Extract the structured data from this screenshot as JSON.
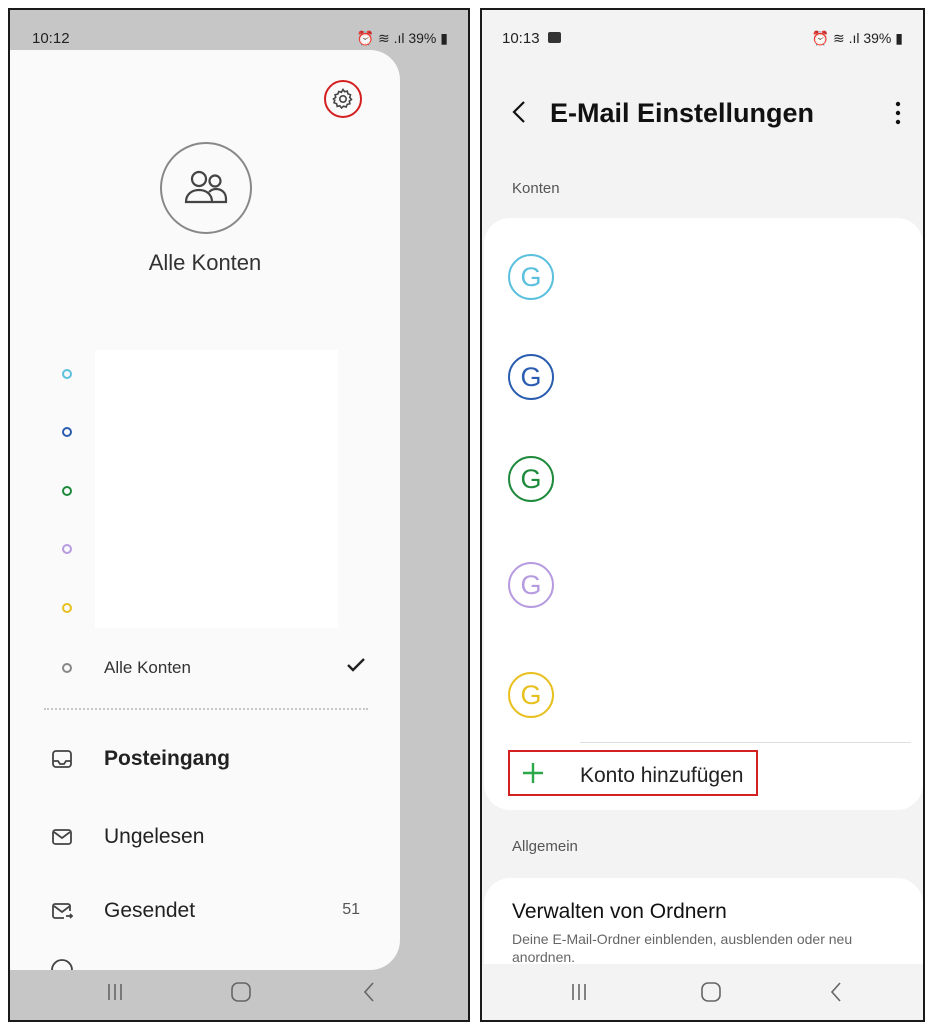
{
  "left": {
    "status": {
      "time": "10:12",
      "battery": "39%"
    },
    "drawer": {
      "settings_icon": "gear-icon",
      "avatar_icon": "people-icon",
      "avatar_label": "Alle Konten",
      "account_dot_colors": [
        "#5bc0de",
        "#2a5db0",
        "#1e8a3c",
        "#b79be0",
        "#e8c020"
      ],
      "all_accounts_label": "Alle Konten",
      "menu": [
        {
          "label": "Posteingang",
          "icon": "inbox-icon",
          "count": ""
        },
        {
          "label": "Ungelesen",
          "icon": "unread-mail-icon",
          "count": ""
        },
        {
          "label": "Gesendet",
          "icon": "sent-mail-icon",
          "count": "51"
        }
      ]
    }
  },
  "right": {
    "status": {
      "time": "10:13",
      "battery": "39%"
    },
    "appbar": {
      "title": "E-Mail Einstellungen"
    },
    "accounts_section_label": "Konten",
    "accounts": [
      {
        "letter": "G",
        "color": "#5bc0de"
      },
      {
        "letter": "G",
        "color": "#2a5db0"
      },
      {
        "letter": "G",
        "color": "#1e8a3c"
      },
      {
        "letter": "G",
        "color": "#b79be0"
      },
      {
        "letter": "G",
        "color": "#e8c020"
      }
    ],
    "add_account_label": "Konto hinzufügen",
    "general_section_label": "Allgemein",
    "manage_folders": {
      "title": "Verwalten von Ordnern",
      "description": "Deine E-Mail-Ordner einblenden, ausblenden oder neu anordnen."
    }
  },
  "colors": {
    "highlight": "#d42020",
    "add_plus": "#2aa84a"
  }
}
